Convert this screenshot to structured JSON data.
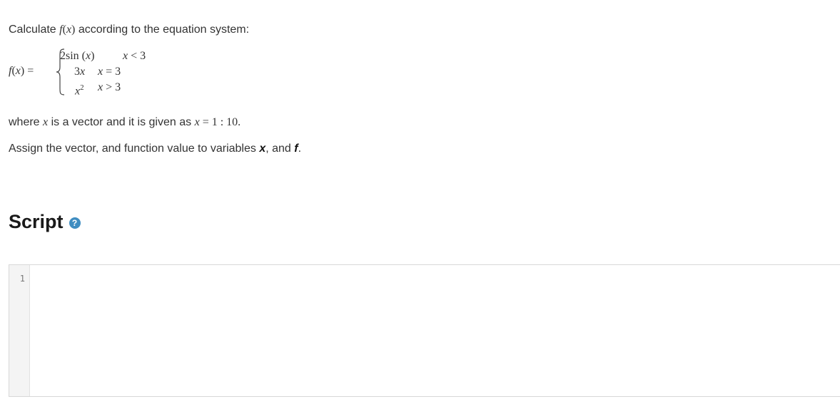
{
  "problem": {
    "intro_prefix": "Calculate ",
    "intro_fx_f": "f",
    "intro_fx_open": "(",
    "intro_fx_x": "x",
    "intro_fx_close": ")",
    "intro_suffix": " according to the equation system:",
    "equation": {
      "lhs_f": "f",
      "lhs_open": "(",
      "lhs_x": "x",
      "lhs_close": ") =",
      "rows": [
        {
          "expr_pre": "2sin (",
          "expr_var": "x",
          "expr_post": ")",
          "cond_var": "x",
          "cond_rel": " < 3"
        },
        {
          "expr_pre": "3",
          "expr_var": "x",
          "expr_post": "",
          "cond_var": "x",
          "cond_rel": " = 3"
        },
        {
          "expr_pre": "",
          "expr_var": "x",
          "expr_post": "2",
          "cond_var": "x",
          "cond_rel": " > 3"
        }
      ]
    },
    "where_prefix": "where ",
    "where_var": "x",
    "where_mid": " is a vector and it is given as ",
    "where_eq_var": "x",
    "where_eq_rest": " = 1 : 10",
    "where_end": ".",
    "assign_prefix": "Assign the vector, and function value to variables ",
    "assign_var_x": "x",
    "assign_mid": ", and ",
    "assign_var_f": "f",
    "assign_end": "."
  },
  "script_section": {
    "heading": "Script",
    "help_icon_glyph": "?",
    "help_icon_color": "#3f8dc1",
    "editor": {
      "line_numbers": [
        "1"
      ],
      "content": ""
    }
  }
}
